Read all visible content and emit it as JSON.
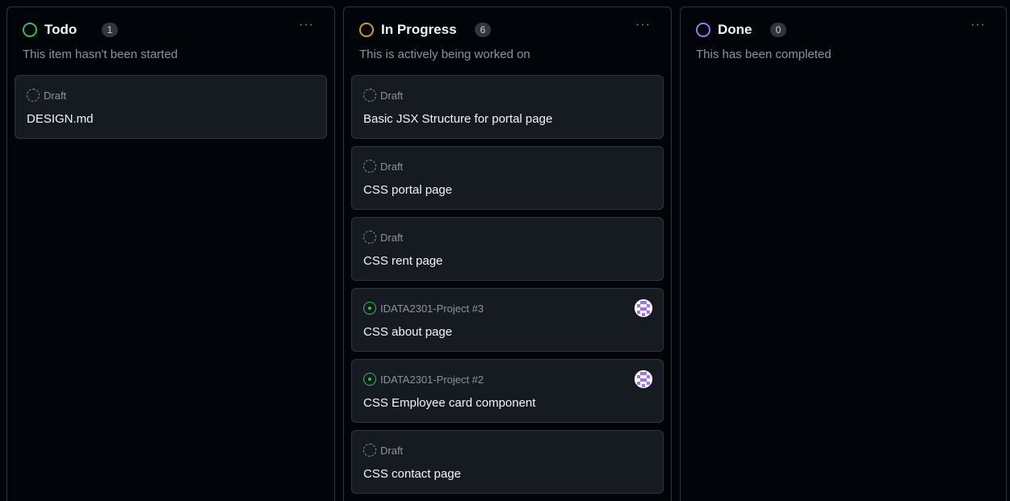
{
  "colors": {
    "todo": "#3fb950",
    "in_progress": "#d29922",
    "done": "#a371f7",
    "issue_open": "#3fb950",
    "avatar": "#a371f7"
  },
  "columns": [
    {
      "title": "Todo",
      "count": "1",
      "description": "This item hasn't been started",
      "menu": "···",
      "cards": [
        {
          "type": "draft",
          "meta": "Draft",
          "title": "DESIGN.md",
          "icon": "draft-icon"
        }
      ]
    },
    {
      "title": "In Progress",
      "count": "6",
      "description": "This is actively being worked on",
      "menu": "···",
      "cards": [
        {
          "type": "draft",
          "meta": "Draft",
          "title": "Basic JSX Structure for portal page",
          "icon": "draft-icon"
        },
        {
          "type": "draft",
          "meta": "Draft",
          "title": "CSS portal page",
          "icon": "draft-icon"
        },
        {
          "type": "draft",
          "meta": "Draft",
          "title": "CSS rent page",
          "icon": "draft-icon"
        },
        {
          "type": "issue",
          "meta": "IDATA2301-Project #3",
          "title": "CSS about page",
          "icon": "issue-opened-icon",
          "avatar": true
        },
        {
          "type": "issue",
          "meta": "IDATA2301-Project #2",
          "title": "CSS Employee card component",
          "icon": "issue-opened-icon",
          "avatar": true
        },
        {
          "type": "draft",
          "meta": "Draft",
          "title": "CSS contact page",
          "icon": "draft-icon"
        }
      ]
    },
    {
      "title": "Done",
      "count": "0",
      "description": "This has been completed",
      "menu": "···",
      "cards": []
    }
  ]
}
